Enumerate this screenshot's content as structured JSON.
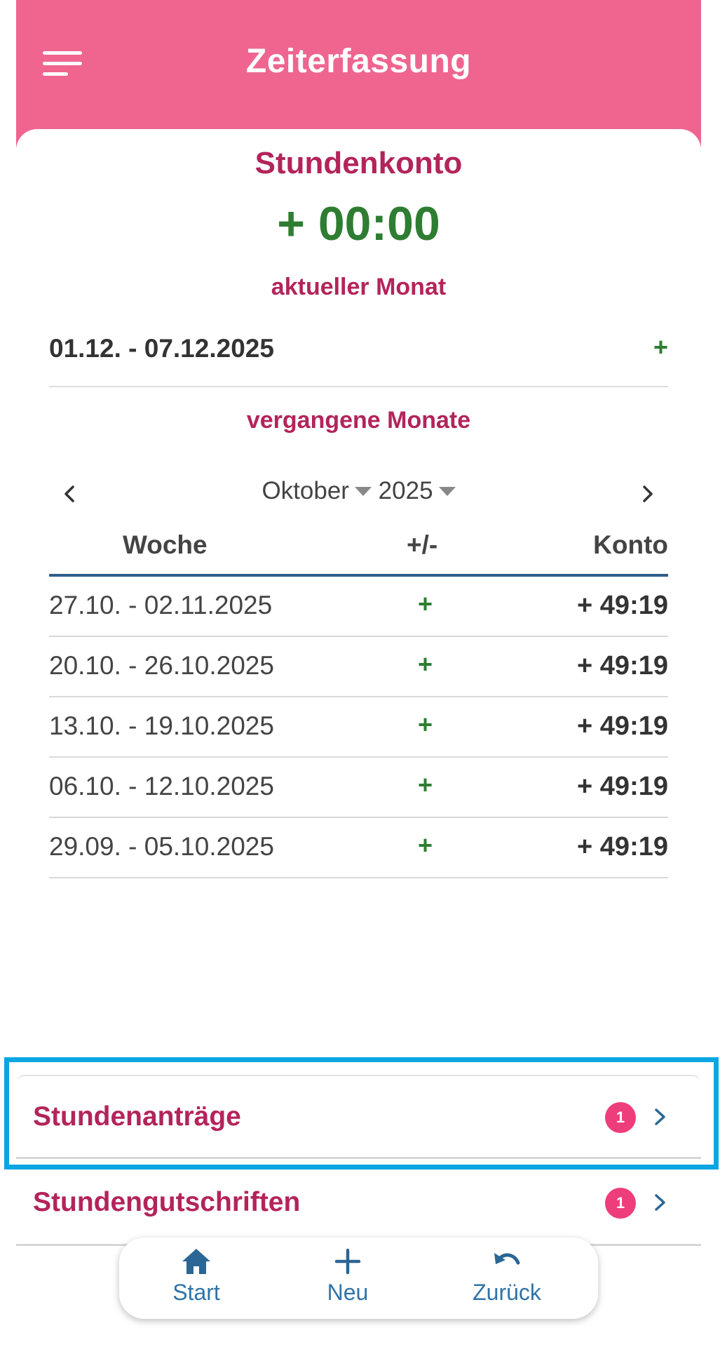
{
  "header": {
    "title": "Zeiterfassung"
  },
  "balance": {
    "title": "Stundenkonto",
    "value": "+ 00:00"
  },
  "current_month": {
    "heading": "aktueller Monat",
    "range": "01.12. - 07.12.2025",
    "sign": "+"
  },
  "past_months": {
    "heading": "vergangene Monate",
    "month": "Oktober",
    "year": "2025"
  },
  "table": {
    "headers": {
      "week": "Woche",
      "diff": "+/-",
      "konto": "Konto"
    },
    "rows": [
      {
        "week": "27.10. - 02.11.2025",
        "diff": "+",
        "konto": "+ 49:19"
      },
      {
        "week": "20.10. - 26.10.2025",
        "diff": "+",
        "konto": "+ 49:19"
      },
      {
        "week": "13.10. - 19.10.2025",
        "diff": "+",
        "konto": "+ 49:19"
      },
      {
        "week": "06.10. - 12.10.2025",
        "diff": "+",
        "konto": "+ 49:19"
      },
      {
        "week": "29.09. - 05.10.2025",
        "diff": "+",
        "konto": "+ 49:19"
      }
    ]
  },
  "links": [
    {
      "label": "Stundenanträge",
      "badge": "1"
    },
    {
      "label": "Stundengutschriften",
      "badge": "1"
    }
  ],
  "bottom_nav": {
    "start": "Start",
    "new": "Neu",
    "back": "Zurück"
  },
  "colors": {
    "header": "#ef6590",
    "accent_pink": "#b3245b",
    "positive_green": "#2e7d32",
    "badge": "#ee3d7b",
    "nav_blue": "#2b6694",
    "highlight": "#0aa6e2"
  },
  "icons": {
    "menu": "hamburger-menu-icon",
    "prev": "chevron-left-icon",
    "next": "chevron-right-icon",
    "home": "home-icon",
    "add": "plus-icon",
    "back": "undo-icon"
  }
}
